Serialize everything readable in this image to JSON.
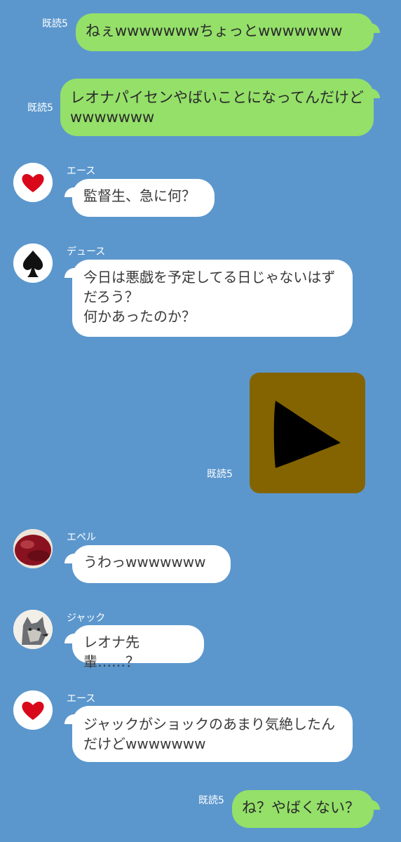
{
  "chat": {
    "read_label": "既読5",
    "messages": [
      {
        "id": "m1",
        "direction": "outgoing",
        "text": "ねぇwwwwwwwちょっとwwwwwww"
      },
      {
        "id": "m2",
        "direction": "outgoing",
        "text": "レオナパイセンやばいことになってんだけどwwwwwww"
      },
      {
        "id": "m3",
        "direction": "incoming",
        "sender": "エース",
        "avatar_icon": "heart-icon",
        "text": "監督生、急に何？"
      },
      {
        "id": "m4",
        "direction": "incoming",
        "sender": "デュース",
        "avatar_icon": "spade-icon",
        "text": "今日は悪戯を予定してる日じゃないはずだろう？\n何かあったのか？"
      },
      {
        "id": "m5",
        "direction": "outgoing",
        "type": "video",
        "thumbnail_icon": "play-icon"
      },
      {
        "id": "m6",
        "direction": "incoming",
        "sender": "エペル",
        "avatar_icon": "apple-avatar",
        "text": "うわっwwwwwww"
      },
      {
        "id": "m7",
        "direction": "incoming",
        "sender": "ジャック",
        "avatar_icon": "wolf-avatar",
        "text": "レオナ先輩……？"
      },
      {
        "id": "m8",
        "direction": "incoming",
        "sender": "エース",
        "avatar_icon": "heart-icon",
        "text": "ジャックがショックのあまり気絶したんだけどwwwwwww"
      },
      {
        "id": "m9",
        "direction": "outgoing",
        "text": "ね？やばくない？"
      }
    ]
  },
  "colors": {
    "background": "#5b97cd",
    "outgoing_bubble": "#94e069",
    "incoming_bubble": "#ffffff",
    "video_thumbnail": "#846400"
  }
}
